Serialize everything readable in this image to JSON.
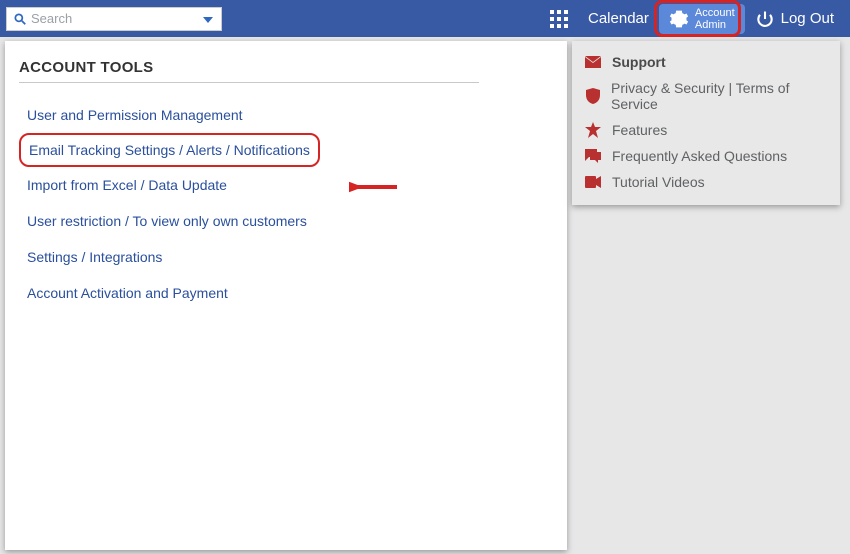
{
  "topbar": {
    "search_placeholder": "Search",
    "calendar_label": "Calendar",
    "account_admin_label": "Account\nAdmin",
    "logout_label": "Log Out"
  },
  "tools": {
    "heading": "ACCOUNT TOOLS",
    "items": [
      "User and Permission Management",
      "Email Tracking Settings / Alerts / Notifications",
      "Import from Excel / Data Update",
      "User restriction / To view only own customers",
      "Settings / Integrations",
      "Account Activation and Payment"
    ],
    "highlight_index": 1
  },
  "menu": {
    "items": [
      {
        "icon": "mail-icon",
        "label": "Support",
        "bold": true
      },
      {
        "icon": "shield-icon",
        "label": "Privacy & Security | Terms of Service"
      },
      {
        "icon": "star-icon",
        "label": "Features"
      },
      {
        "icon": "chat-icon",
        "label": "Frequently Asked Questions"
      },
      {
        "icon": "video-icon",
        "label": "Tutorial Videos"
      }
    ]
  },
  "colors": {
    "brand": "#3859a3",
    "accent": "#d62424",
    "link": "#2a4f9c"
  }
}
